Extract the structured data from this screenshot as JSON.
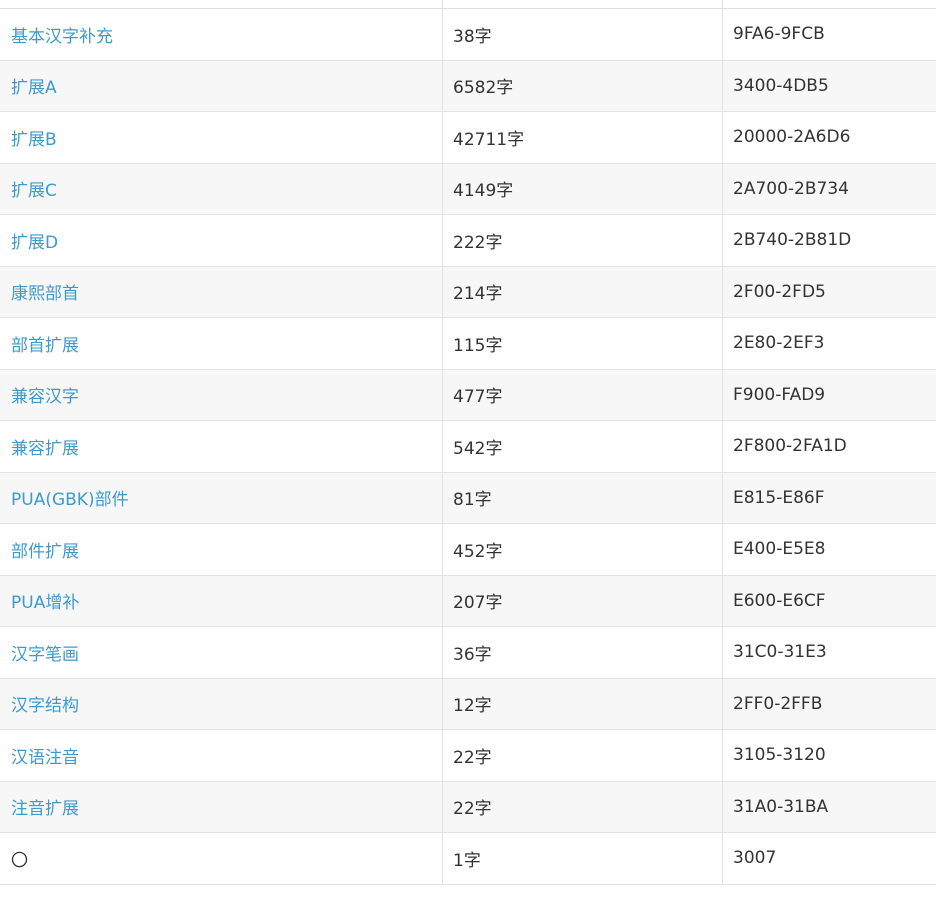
{
  "rows": [
    {
      "name": "基本汉字补充",
      "count": "38字",
      "range": "9FA6-9FCB",
      "link": true
    },
    {
      "name": "扩展A",
      "count": "6582字",
      "range": "3400-4DB5",
      "link": true
    },
    {
      "name": "扩展B",
      "count": "42711字",
      "range": "20000-2A6D6",
      "link": true
    },
    {
      "name": "扩展C",
      "count": "4149字",
      "range": "2A700-2B734",
      "link": true
    },
    {
      "name": "扩展D",
      "count": "222字",
      "range": "2B740-2B81D",
      "link": true
    },
    {
      "name": "康熙部首",
      "count": "214字",
      "range": "2F00-2FD5",
      "link": true
    },
    {
      "name": "部首扩展",
      "count": "115字",
      "range": "2E80-2EF3",
      "link": true
    },
    {
      "name": "兼容汉字",
      "count": "477字",
      "range": "F900-FAD9",
      "link": true
    },
    {
      "name": "兼容扩展",
      "count": "542字",
      "range": "2F800-2FA1D",
      "link": true
    },
    {
      "name": "PUA(GBK)部件",
      "count": "81字",
      "range": "E815-E86F",
      "link": true
    },
    {
      "name": "部件扩展",
      "count": "452字",
      "range": "E400-E5E8",
      "link": true
    },
    {
      "name": "PUA增补",
      "count": "207字",
      "range": "E600-E6CF",
      "link": true
    },
    {
      "name": "汉字笔画",
      "count": "36字",
      "range": "31C0-31E3",
      "link": true
    },
    {
      "name": "汉字结构",
      "count": "12字",
      "range": "2FF0-2FFB",
      "link": true
    },
    {
      "name": "汉语注音",
      "count": "22字",
      "range": "3105-3120",
      "link": true
    },
    {
      "name": "注音扩展",
      "count": "22字",
      "range": "31A0-31BA",
      "link": true
    },
    {
      "name": "〇",
      "count": "1字",
      "range": "3007",
      "link": false
    }
  ],
  "colors": {
    "link": "#3d9bcc",
    "text": "#333333",
    "alt_row": "#f7f7f7",
    "border": "#e3e3e3"
  }
}
